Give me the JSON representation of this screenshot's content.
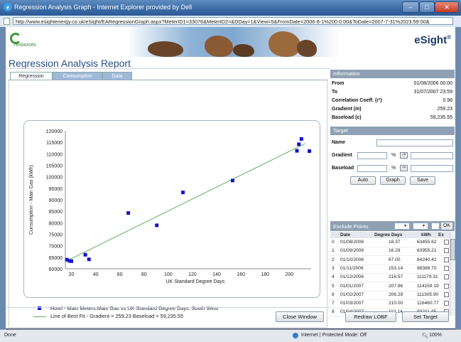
{
  "window": {
    "title": "Regression Analysis Graph - Internet Explorer provided by Dell",
    "url": "http://www.esightenergy.co.uk/eSight/EARegressionGraph.aspx?MeterID1=33076&MeterID2=&DDay=1&View=5&FromDate=2006-8-1%200:0:00&ToDate=2007-7-31%2023:59:00&",
    "minimize": "–",
    "maximize": "□",
    "close": "✕"
  },
  "brand": {
    "logo_text": "resources",
    "product": "eSight",
    "reg": "®"
  },
  "page_title": "Regression Analysis Report",
  "tabs": [
    {
      "label": "Regression"
    },
    {
      "label": "Consumption"
    },
    {
      "label": "Data"
    }
  ],
  "chart_data": {
    "type": "scatter",
    "title": "",
    "xlabel": "UK Standard Degree Days",
    "ylabel": "Consumption - Main Gas (kWh)",
    "xlim": [
      15,
      218
    ],
    "ylim": [
      60000,
      120000
    ],
    "xticks": [
      20,
      40,
      60,
      80,
      100,
      120,
      140,
      160,
      180,
      200
    ],
    "yticks": [
      60000,
      65000,
      70000,
      75000,
      80000,
      85000,
      90000,
      95000,
      100000,
      105000,
      110000,
      115000,
      120000
    ],
    "x": [
      16.29,
      18.37,
      20,
      31.5,
      34.5,
      67.0,
      90.5,
      112.14,
      153.14,
      206.29,
      207.86,
      210.0,
      216.57
    ],
    "y": [
      63955,
      63455,
      63300,
      66100,
      64100,
      84240,
      78900,
      93211,
      98388,
      111305,
      114159,
      116460,
      111179
    ],
    "series": [
      {
        "name": "Hotel - Main Meters.Main Gas vs UK Standard Degree Days: South West",
        "color": "#1515c8"
      },
      {
        "name": "Line of Best Fit - Gradient = 259.23 Baseload = 59,235.55",
        "color": "#5cb25c"
      }
    ],
    "fit": {
      "gradient": 259.23,
      "baseload": 59235.55
    },
    "grid": false,
    "legend_position": "bottom"
  },
  "legend": {
    "points": "Hotel - Main Meters.Main Gas vs UK Standard Degree Days: South West",
    "fit": "Line of Best Fit - Gradient = 259.23 Baseload = 59,235.55"
  },
  "information": {
    "header": "Information",
    "from_label": "From",
    "from": "01/08/2006 00:00",
    "to_label": "To",
    "to": "31/07/2007 23:59",
    "corr_label": "Correlation Coeff. (r²)",
    "corr": "0.98",
    "gradient_label": "Gradient (m)",
    "gradient": "259.23",
    "baseload_label": "Baseload (c)",
    "baseload": "59,235.55"
  },
  "target": {
    "header": "Target",
    "name_label": "Name",
    "gradient_label": "Gradient",
    "baseload_label": "Baseload",
    "pct": "%",
    "arrow": "->",
    "auto": "Auto",
    "graph": "Graph",
    "save": "Save"
  },
  "exclude": {
    "header": "Exclude Points",
    "ok": "OK",
    "columns": [
      "Date",
      "Degree Days",
      "kWh",
      "Ex"
    ],
    "rows": [
      {
        "i": "0",
        "date": "01/08/2006",
        "dd": "18.37",
        "kwh": "63455.62"
      },
      {
        "i": "1",
        "date": "01/09/2006",
        "dd": "16.29",
        "kwh": "63955.21"
      },
      {
        "i": "2",
        "date": "01/10/2006",
        "dd": "67.00",
        "kwh": "84240.42"
      },
      {
        "i": "3",
        "date": "01/11/2006",
        "dd": "153.14",
        "kwh": "98388.70"
      },
      {
        "i": "4",
        "date": "01/12/2006",
        "dd": "216.57",
        "kwh": "111179.31"
      },
      {
        "i": "5",
        "date": "01/01/2007",
        "dd": "207.86",
        "kwh": "114159.19"
      },
      {
        "i": "6",
        "date": "01/02/2007",
        "dd": "206.29",
        "kwh": "111305.90"
      },
      {
        "i": "7",
        "date": "01/03/2007",
        "dd": "210.00",
        "kwh": "116460.77"
      },
      {
        "i": "8",
        "date": "01/04/2007",
        "dd": "112.14",
        "kwh": "93211.45"
      }
    ]
  },
  "buttons": {
    "close_window": "Close Window",
    "redraw_lobf": "Redraw LOBF",
    "set_target": "Set Target"
  },
  "status": {
    "left": "Done",
    "zone": "Internet | Protected Mode: Off",
    "zoom": "100%"
  }
}
